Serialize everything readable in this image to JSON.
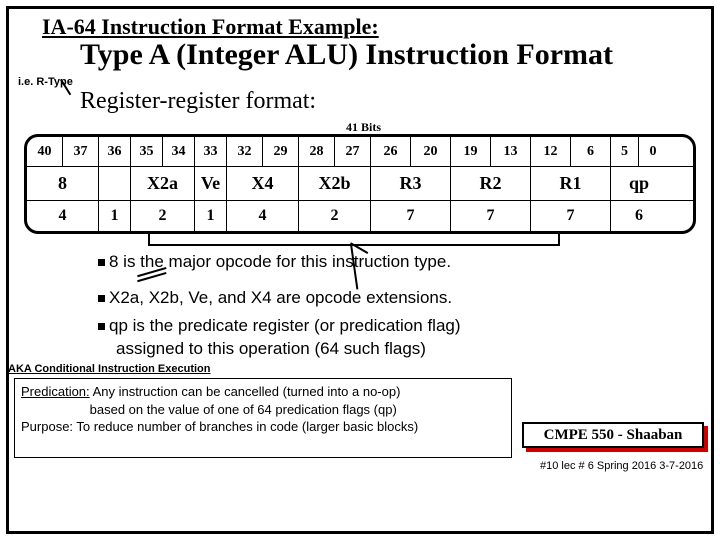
{
  "title1": "IA-64 Instruction Format Example:",
  "title2": "Type A (Integer ALU) Instruction Format",
  "note_rtype": "i.e. R-Type",
  "subtitle": "Register-register format:",
  "bits_label": "41 Bits",
  "table": {
    "bit_positions": [
      "40",
      "37",
      "36",
      "35",
      "34",
      "33",
      "32",
      "29",
      "28",
      "27",
      "26",
      "20",
      "19",
      "13",
      "12",
      "6",
      "5",
      "0"
    ],
    "fields": [
      "8",
      "",
      "X2a",
      "Ve",
      "X4",
      "X2b",
      "R3",
      "R2",
      "R1",
      "qp"
    ],
    "widths": [
      "4",
      "1",
      "2",
      "1",
      "4",
      "2",
      "7",
      "7",
      "7",
      "6"
    ]
  },
  "bullets": {
    "b1": "8 is the major opcode for this instruction type.",
    "b2": "X2a, X2b, Ve, and X4 are opcode extensions.",
    "b3a": "qp is the predicate register (or predication flag)",
    "b3b": "assigned to this operation (64 such flags)"
  },
  "aka": "AKA Conditional Instruction Execution",
  "predication": {
    "label": "Predication:",
    "line1": "Any instruction can be cancelled (turned into a no-op)",
    "line2": "based on the value of one of 64 predication flags (qp)",
    "line3": "Purpose: To reduce number of branches in code (larger basic blocks)"
  },
  "course": "CMPE 550 - Shaaban",
  "footer": "#10  lec # 6  Spring 2016  3-7-2016"
}
